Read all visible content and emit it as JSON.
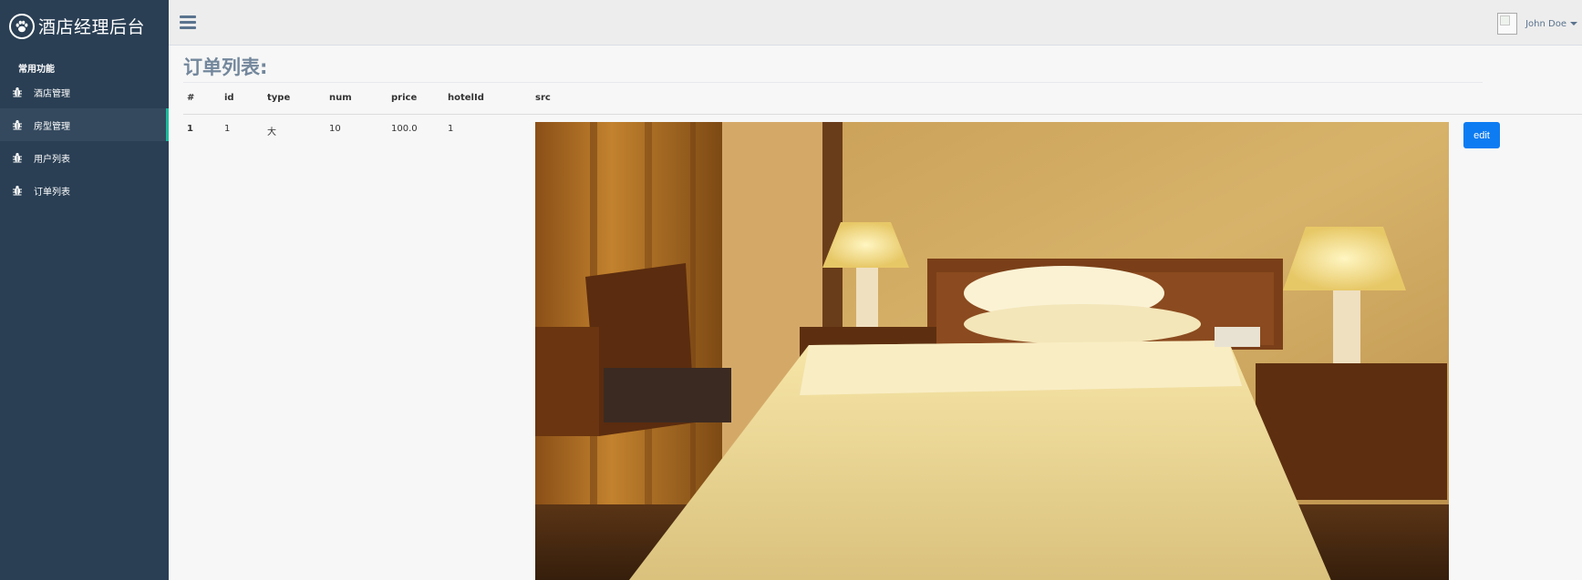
{
  "sidebar": {
    "brand_title": "酒店经理后台",
    "section_title": "常用功能",
    "items": [
      {
        "label": "酒店管理",
        "icon": "bug-icon",
        "active": false
      },
      {
        "label": "房型管理",
        "icon": "bug-icon",
        "active": true
      },
      {
        "label": "用户列表",
        "icon": "bug-icon",
        "active": false
      },
      {
        "label": "订单列表",
        "icon": "bug-icon",
        "active": false
      }
    ]
  },
  "topbar": {
    "menu_icon": "hamburger-icon",
    "user_name": "John Doe"
  },
  "main": {
    "title": "订单列表:",
    "table": {
      "headers": [
        "#",
        "id",
        "type",
        "num",
        "price",
        "hotelId",
        "src"
      ],
      "rows": [
        {
          "index": "1",
          "id": "1",
          "type": "大",
          "num": "10",
          "price": "100.0",
          "hotelId": "1",
          "action": "edit"
        }
      ]
    }
  },
  "colors": {
    "sidebar_bg": "#2a3f54",
    "active_accent": "#1abb9c",
    "button_blue": "#0d7cf2",
    "title_color": "#73879c"
  }
}
